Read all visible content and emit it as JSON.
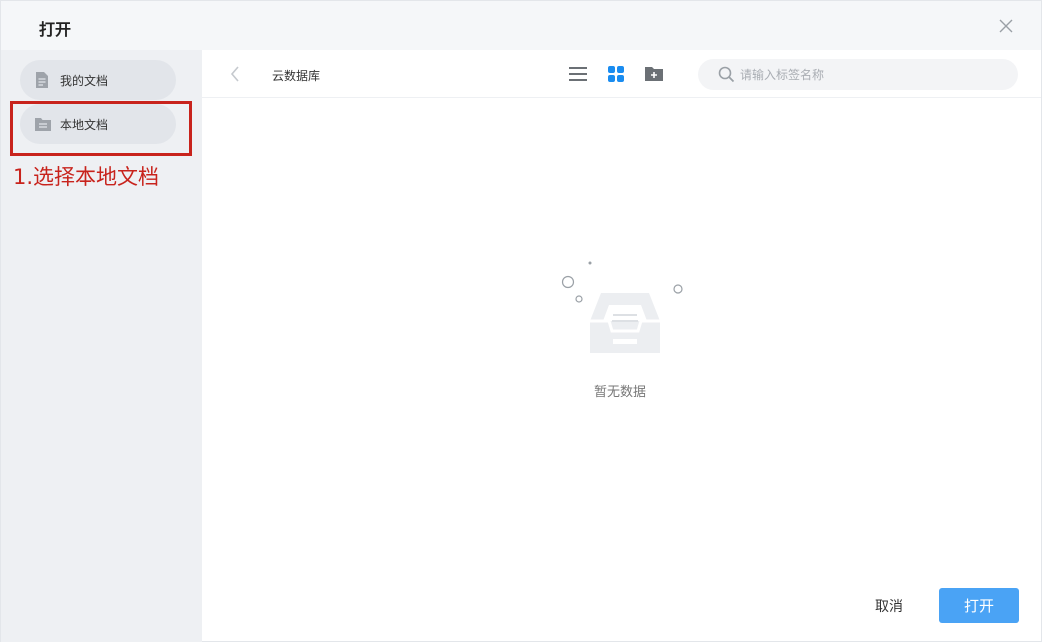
{
  "dialog": {
    "title": "打开",
    "close_icon": "close-icon"
  },
  "sidebar": {
    "items": [
      {
        "label": "我的文档",
        "icon": "document-icon"
      },
      {
        "label": "本地文档",
        "icon": "folder-icon"
      }
    ]
  },
  "annotation": {
    "text": "1.选择本地文档",
    "color": "#c8231c"
  },
  "toolbar": {
    "back_icon": "chevron-left-icon",
    "breadcrumb": "云数据库",
    "view_icons": [
      "list-view-icon",
      "grid-view-icon",
      "new-folder-icon"
    ],
    "active_view": "grid-view-icon",
    "search": {
      "placeholder": "请输入标签名称",
      "value": ""
    }
  },
  "empty_state": {
    "icon": "empty-inbox-icon",
    "text": "暂无数据"
  },
  "footer": {
    "cancel_label": "取消",
    "open_label": "打开"
  },
  "colors": {
    "accent": "#4aa3f5",
    "active_icon": "#1a8cf0",
    "sidebar_bg": "#eef0f3",
    "annotation": "#c8231c"
  }
}
